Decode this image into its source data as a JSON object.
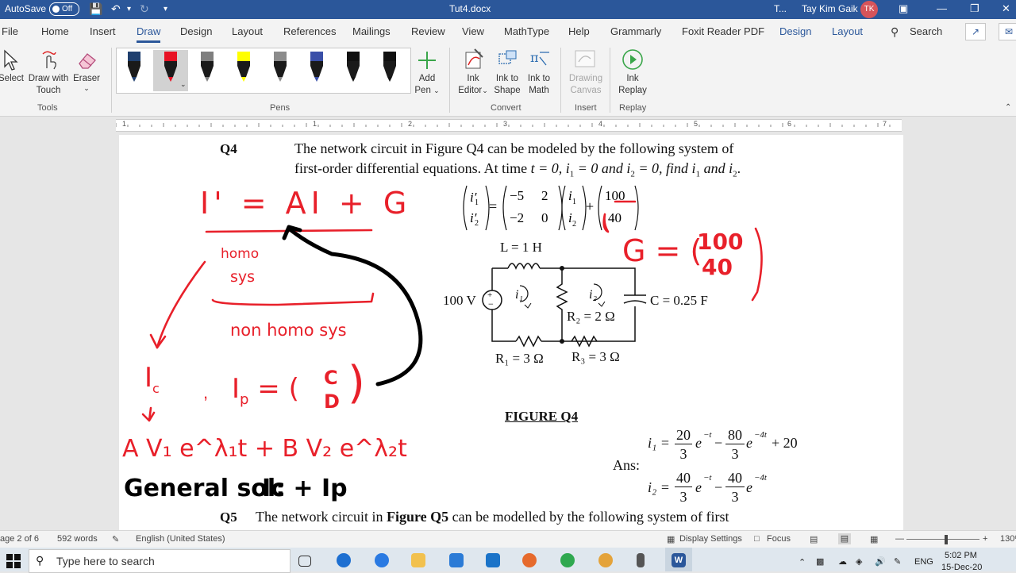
{
  "titlebar": {
    "autosave_label": "AutoSave",
    "autosave_state": "Off",
    "filename": "Tut4.docx",
    "sensitivity": "T...",
    "user_name": "Tay Kim Gaik",
    "user_initials": "TK"
  },
  "tabs": [
    "File",
    "Home",
    "Insert",
    "Draw",
    "Design",
    "Layout",
    "References",
    "Mailings",
    "Review",
    "View",
    "MathType",
    "Help",
    "Grammarly",
    "Foxit Reader PDF",
    "Design",
    "Layout"
  ],
  "active_tab": "Draw",
  "search_label": "Search",
  "ribbon": {
    "tools": {
      "select": "Select",
      "draw_touch_1": "Draw with",
      "draw_touch_2": "Touch",
      "eraser": "Eraser",
      "group": "Tools"
    },
    "pens_group": "Pens",
    "pens": [
      {
        "color": "#1f3f6e"
      },
      {
        "color": "#e81123"
      },
      {
        "color": "#7f7f7f"
      },
      {
        "color": "#ffff00"
      },
      {
        "color": "#8c8c8c"
      },
      {
        "color": "#3a4fa8"
      },
      {
        "color": "#111111"
      },
      {
        "color": "#111111"
      }
    ],
    "add_pen_1": "Add",
    "add_pen_2": "Pen",
    "ink_editor_1": "Ink",
    "ink_editor_2": "Editor",
    "ink_shape_1": "Ink to",
    "ink_shape_2": "Shape",
    "ink_math_1": "Ink to",
    "ink_math_2": "Math",
    "convert_group": "Convert",
    "drawing_canvas_1": "Drawing",
    "drawing_canvas_2": "Canvas",
    "insert_group": "Insert",
    "ink_replay_1": "Ink",
    "ink_replay_2": "Replay",
    "replay_group": "Replay"
  },
  "ruler_numbers": [
    "1",
    "1",
    "2",
    "3",
    "4",
    "5",
    "6",
    "7"
  ],
  "document": {
    "q4_label": "Q4",
    "q4_line1": "The network circuit in Figure Q4 can be modeled by the following system of",
    "q4_line2_a": "first-order differential equations. At time",
    "q4_line2_b": "t = 0, i",
    "q4_line2_c": " = 0  and  i",
    "q4_line2_d": " = 0,  find  i",
    "q4_line2_e": "  and  i",
    "matrix": {
      "a11": "−5",
      "a12": "2",
      "a21": "−2",
      "a22": "0",
      "g1": "100",
      "g2": "40"
    },
    "circuit": {
      "inductor": "L = 1 H",
      "source": "100 V",
      "capacitor": "C = 0.25 F",
      "r1": "R₁ = 3 Ω",
      "r2": "R₂ = 2  Ω",
      "r3": "R₃ = 3 Ω",
      "i1": "i₁",
      "i2": "i₂"
    },
    "figure_caption": "FIGURE Q4",
    "ans_label": "Ans:",
    "ans_i1": {
      "lhs": "i₁ =",
      "c1_num": "20",
      "c1_den": "3",
      "e1": "e",
      "x1": "−t",
      "minus": "−",
      "c2_num": "80",
      "c2_den": "3",
      "x2": "−4t",
      "tail": "+ 20"
    },
    "ans_i2": {
      "lhs": "i₂ =",
      "c1_num": "40",
      "c1_den": "3",
      "x1": "−t",
      "c2_num": "40",
      "c2_den": "3",
      "x2": "−4t"
    },
    "q5_label": "Q5",
    "q5_text_a": "The network circuit in ",
    "q5_text_b": "Figure Q5",
    "q5_text_c": " can be modelled by the following system of first"
  },
  "ink": {
    "eq_main": "I' = AI + G",
    "homo": "homo",
    "sys": "sys",
    "non_homo": "non homo sys",
    "ic": "I",
    "ic_sub": "c",
    "ip": "I",
    "ip_sub": "p",
    "ip_eq": "= (",
    "ip_c": "C",
    "ip_d": "D",
    "g_eq": "G = (",
    "g_100": "100",
    "g_40": "40",
    "gen_sol_ink": "A V₁ e^λ₁t + B V₂ e^λ₂t",
    "general_sol": "General sol:",
    "ic_ip": "Ic + Ip",
    "red": "#e8202a",
    "black": "#000000"
  },
  "status": {
    "page": "age 2 of 6",
    "words": "592 words",
    "language": "English (United States)",
    "display_settings": "Display Settings",
    "focus": "Focus",
    "zoom": "130"
  },
  "taskbar": {
    "search_placeholder": "Type here to search",
    "lang": "ENG",
    "time": "5:02 PM",
    "date": "15-Dec-20"
  }
}
